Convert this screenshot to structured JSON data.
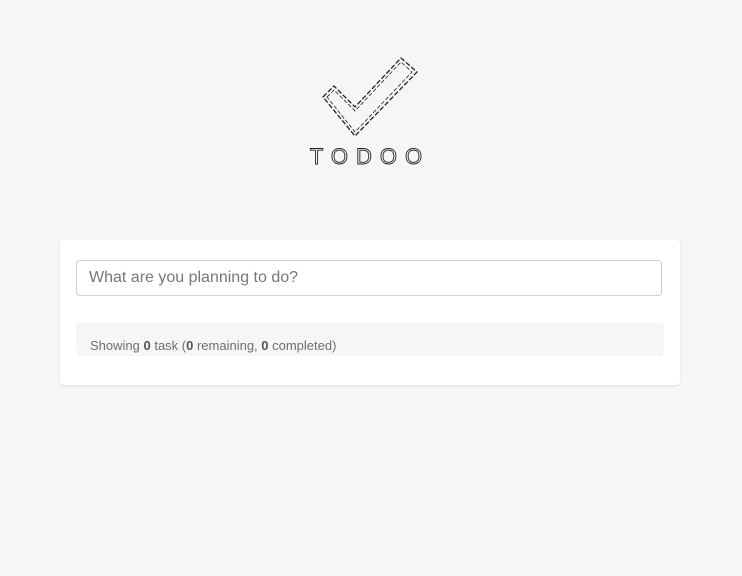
{
  "app": {
    "logo_text": "TODOO",
    "logo_icon": "checkmark-icon"
  },
  "new_task": {
    "placeholder": "What are you planning to do?",
    "value": ""
  },
  "summary": {
    "prefix": "Showing ",
    "total": "0",
    "total_label": " task (",
    "remaining": "0",
    "remaining_label": " remaining, ",
    "completed": "0",
    "completed_label": " completed)"
  },
  "colors": {
    "background": "#f6f6f6",
    "card": "#ffffff",
    "input_border": "#cfcfcf",
    "muted_text": "#6f6f6f"
  }
}
